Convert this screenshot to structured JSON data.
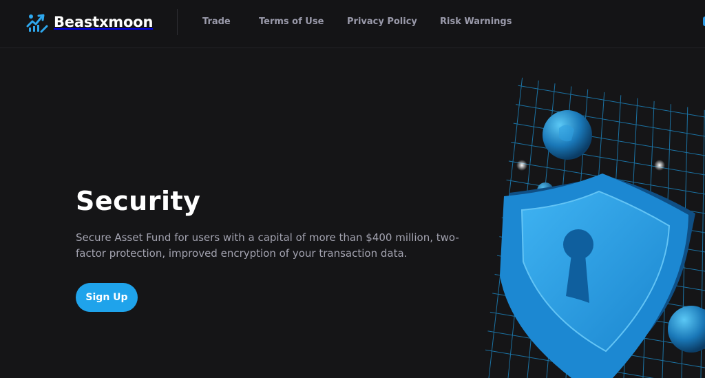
{
  "header": {
    "brand_name": "Beastxmoon",
    "logo_icon": "rising-chart-logo-icon",
    "nav": [
      {
        "label": "Trade"
      },
      {
        "label": "Terms of Use"
      },
      {
        "label": "Privacy Policy"
      },
      {
        "label": "Risk Warnings"
      }
    ]
  },
  "hero": {
    "title": "Security",
    "description": "Secure Asset Fund for users with a capital of more than $400 million, two-factor protection, improved encryption of your transaction data.",
    "cta_label": "Sign Up",
    "illustration_icon": "shield-keyhole-icon"
  },
  "colors": {
    "background": "#151517",
    "accent": "#1fa3eb",
    "nav_text": "#9a9aaa",
    "body_text": "#a3a3b0"
  }
}
